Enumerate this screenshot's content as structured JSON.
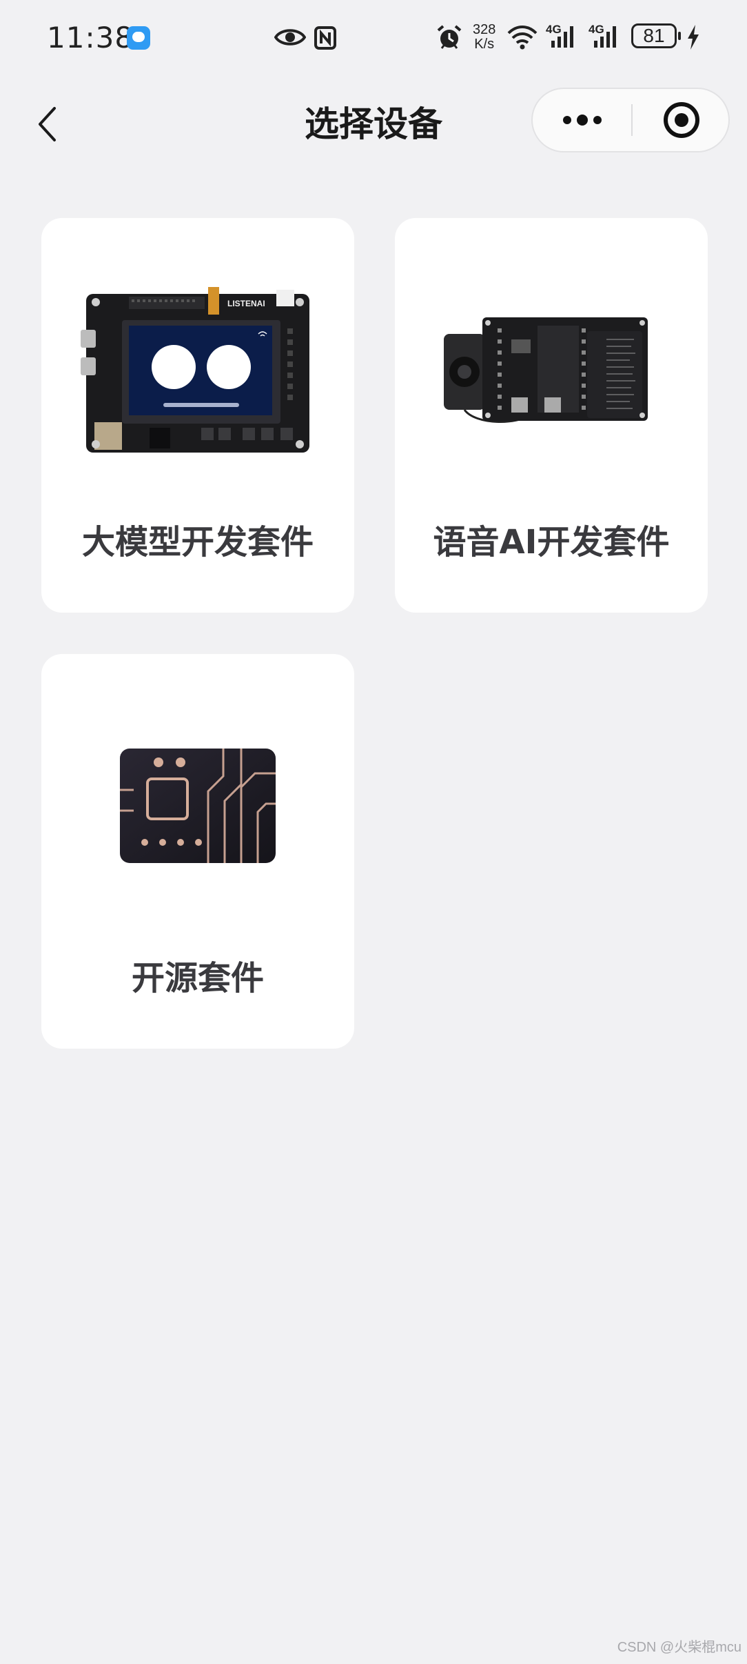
{
  "status_bar": {
    "time": "11:38",
    "speed_value": "328",
    "speed_unit": "K/s",
    "network_1": "4G",
    "network_2": "4G",
    "battery": "81",
    "icons": [
      "chat-notification-icon",
      "eye-icon",
      "nfc-icon",
      "alarm-icon",
      "wifi-icon",
      "signal-icon",
      "battery-icon",
      "charging-icon"
    ]
  },
  "nav": {
    "title": "选择设备",
    "back_icon": "chevron-left-icon",
    "more_icon": "more-dots-icon",
    "close_icon": "target-close-icon"
  },
  "devices": [
    {
      "label": "大模型开发套件",
      "image": "dev-board-with-screen"
    },
    {
      "label": "语音AI开发套件",
      "image": "voice-board-with-speaker"
    },
    {
      "label": "开源套件",
      "image": "chip-circuit-card"
    }
  ],
  "watermark": "CSDN @火柴棍mcu",
  "colors": {
    "background": "#f1f1f3",
    "card": "#ffffff",
    "label": "#3a3a3e"
  }
}
